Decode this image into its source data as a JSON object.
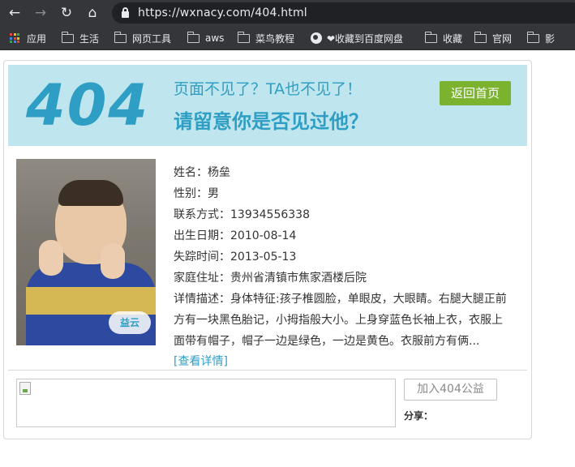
{
  "browser": {
    "url": "https://wxnacy.com/404.html",
    "bookmarks": [
      {
        "label": "应用",
        "icon": "apps-icon"
      },
      {
        "label": "生活",
        "icon": "folder-icon"
      },
      {
        "label": "网页工具",
        "icon": "folder-icon"
      },
      {
        "label": "aws",
        "icon": "folder-icon"
      },
      {
        "label": "菜鸟教程",
        "icon": "folder-icon"
      },
      {
        "label": "❤收藏到百度网盘",
        "icon": "globe-icon"
      },
      {
        "label": "收藏",
        "icon": "folder-icon"
      },
      {
        "label": "官网",
        "icon": "folder-icon"
      },
      {
        "label": "影",
        "icon": "folder-icon"
      }
    ]
  },
  "banner": {
    "code": "404",
    "line1": "页面不见了？TA也不见了！",
    "line2": "请留意你是否见过他？",
    "home_button": "返回首页",
    "bg_color": "#bfe6ee",
    "accent_color": "#2f9ec4",
    "button_color": "#7bb32e"
  },
  "photo": {
    "watermark": "益云"
  },
  "person": {
    "name": "姓名：杨垒",
    "gender": "性别：男",
    "contact": "联系方式：13934556338",
    "birth": "出生日期：2010-08-14",
    "missing": "失踪时间：2013-05-13",
    "address": "家庭住址：贵州省清镇市焦家酒楼后院",
    "desc_line1": "详情描述：身体特征:孩子椎圆脸，单眼皮，大眼睛。右腿大腿正前",
    "desc_line2": "方有一块黑色胎记，小拇指般大小。上身穿蓝色长袖上衣，衣服上",
    "desc_line3": "面带有帽子，帽子一边是绿色，一边是黄色。衣服前方有俩...",
    "more_link": "[查看详情]"
  },
  "footer": {
    "join_button": "加入404公益",
    "share_label": "分享："
  }
}
